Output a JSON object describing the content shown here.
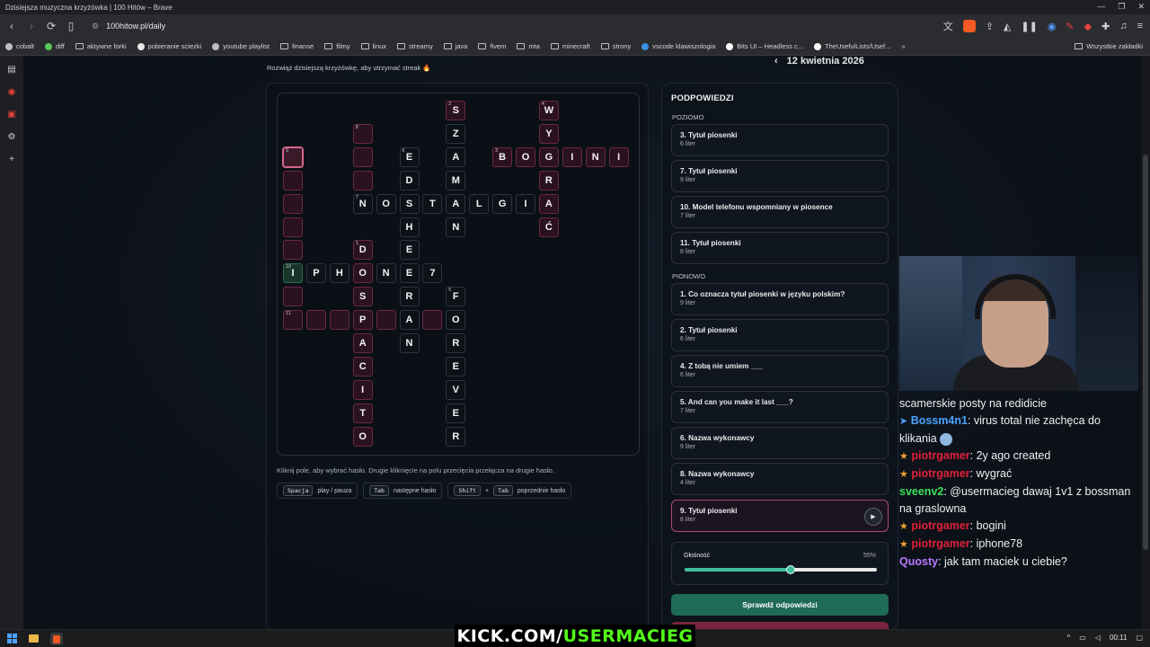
{
  "window": {
    "title": "Dzisiejsza muzyczna krzyżówka | 100 Hitów – Brave"
  },
  "addressbar": {
    "url": "100hitow.pl/daily"
  },
  "bookmarks": [
    "cobalt",
    "diff",
    "aktywne forki",
    "pobieranie sciezki",
    "youtube playlist",
    "finanse",
    "filmy",
    "linux",
    "streamy",
    "java",
    "fivem",
    "mta",
    "minecraft",
    "strony",
    "vscode klawiszologia",
    "Bits UI – Headless c...",
    "TheUsefulLists/Usef...",
    "Wszystkie zakładki"
  ],
  "page": {
    "subtitle": "Rozwiąż dzisiejszą krzyżówkę, aby utrzymać streak 🔥",
    "date": "12 kwietnia 2026",
    "hint_text": "Kliknij pole, aby wybrać hasło. Drugie kliknięcie na polu przecięcia przełącza na drugie hasło.",
    "keys": [
      {
        "keys": [
          "Spacja"
        ],
        "label": "play / pauza"
      },
      {
        "keys": [
          "Tab"
        ],
        "label": "następne hasło"
      },
      {
        "keys": [
          "Shift",
          "Tab"
        ],
        "label": "poprzednie hasło"
      }
    ]
  },
  "clues": {
    "title": "PODPOWIEDZI",
    "across_label": "POZIOMO",
    "down_label": "PIONOWO",
    "across": [
      {
        "title": "3. Tytuł piosenki",
        "len": "6 liter"
      },
      {
        "title": "7. Tytuł piosenki",
        "len": "9 liter"
      },
      {
        "title": "10. Model telefonu wspomniany w piosence",
        "len": "7 liter"
      },
      {
        "title": "11. Tytuł piosenki",
        "len": "8 liter"
      }
    ],
    "down": [
      {
        "title": "1. Co oznacza tytuł piosenki w języku polskim?",
        "len": "9 liter"
      },
      {
        "title": "2. Tytuł piosenki",
        "len": "6 liter"
      },
      {
        "title": "4. Z tobą nie umiem ___",
        "len": "6 liter"
      },
      {
        "title": "5. And can you make it last ___?",
        "len": "7 liter"
      },
      {
        "title": "6. Nazwa wykonawcy",
        "len": "9 liter"
      },
      {
        "title": "8. Nazwa wykonawcy",
        "len": "4 liter"
      },
      {
        "title": "9. Tytuł piosenki",
        "len": "8 liter"
      }
    ],
    "volume_label": "Głośność",
    "volume_value": "55%",
    "volume_fraction": 0.55,
    "check_button": "Sprawdź odpowiedzi"
  },
  "chat": [
    {
      "user": "",
      "text": "scamerskie posty na redidicie",
      "color": ""
    },
    {
      "user": "Bossm4n1",
      "text": ": virus total nie zachęca do klikania",
      "color": "blue",
      "badge": "pin"
    },
    {
      "user": "piotrgamer",
      "text": ": 2y ago created",
      "color": "red",
      "badge": "star"
    },
    {
      "user": "piotrgamer",
      "text": ": wygrać",
      "color": "red",
      "badge": "star"
    },
    {
      "user": "sveenv2",
      "text": ": @usermacieg dawaj 1v1 z bossman na graslowna",
      "color": "green",
      "badge": ""
    },
    {
      "user": "piotrgamer",
      "text": ": bogini",
      "color": "red",
      "badge": "star"
    },
    {
      "user": "piotrgamer",
      "text": ": iphone78",
      "color": "red",
      "badge": "star"
    },
    {
      "user": "Quosty",
      "text": ": jak tam maciek u ciebie?",
      "color": "purple",
      "badge": ""
    }
  ],
  "overlay": {
    "kick_prefix": "KICK.COM/",
    "kick_name": "USERMACIEG"
  },
  "taskbar": {
    "time": "00:11"
  },
  "grid": {
    "cells": [
      {
        "c": 7,
        "r": 0,
        "l": "S",
        "n": "2",
        "t": "pink"
      },
      {
        "c": 11,
        "r": 0,
        "l": "W",
        "n": "4",
        "t": "pink"
      },
      {
        "c": 3,
        "r": 1,
        "l": "",
        "n": "8",
        "t": "pink"
      },
      {
        "c": 7,
        "r": 1,
        "l": "Z",
        "n": "",
        "t": ""
      },
      {
        "c": 11,
        "r": 1,
        "l": "Y",
        "n": "",
        "t": "pink"
      },
      {
        "c": 0,
        "r": 2,
        "l": "",
        "n": "9",
        "t": "sel"
      },
      {
        "c": 3,
        "r": 2,
        "l": "",
        "n": "",
        "t": "pink"
      },
      {
        "c": 5,
        "r": 2,
        "l": "E",
        "n": "6",
        "t": ""
      },
      {
        "c": 7,
        "r": 2,
        "l": "A",
        "n": "",
        "t": ""
      },
      {
        "c": 9,
        "r": 2,
        "l": "B",
        "n": "3",
        "t": "pink"
      },
      {
        "c": 10,
        "r": 2,
        "l": "O",
        "n": "",
        "t": "pink"
      },
      {
        "c": 11,
        "r": 2,
        "l": "G",
        "n": "",
        "t": "pink"
      },
      {
        "c": 12,
        "r": 2,
        "l": "I",
        "n": "",
        "t": "pink"
      },
      {
        "c": 13,
        "r": 2,
        "l": "N",
        "n": "",
        "t": "pink"
      },
      {
        "c": 14,
        "r": 2,
        "l": "I",
        "n": "",
        "t": "pink"
      },
      {
        "c": 0,
        "r": 3,
        "l": "",
        "n": "",
        "t": "pink"
      },
      {
        "c": 3,
        "r": 3,
        "l": "",
        "n": "",
        "t": "pink"
      },
      {
        "c": 5,
        "r": 3,
        "l": "D",
        "n": "",
        "t": ""
      },
      {
        "c": 7,
        "r": 3,
        "l": "M",
        "n": "",
        "t": ""
      },
      {
        "c": 11,
        "r": 3,
        "l": "R",
        "n": "",
        "t": "pink"
      },
      {
        "c": 0,
        "r": 4,
        "l": "",
        "n": "",
        "t": "pink"
      },
      {
        "c": 3,
        "r": 4,
        "l": "N",
        "n": "7",
        "t": ""
      },
      {
        "c": 4,
        "r": 4,
        "l": "O",
        "n": "",
        "t": ""
      },
      {
        "c": 5,
        "r": 4,
        "l": "S",
        "n": "",
        "t": ""
      },
      {
        "c": 6,
        "r": 4,
        "l": "T",
        "n": "",
        "t": ""
      },
      {
        "c": 7,
        "r": 4,
        "l": "A",
        "n": "",
        "t": ""
      },
      {
        "c": 8,
        "r": 4,
        "l": "L",
        "n": "",
        "t": ""
      },
      {
        "c": 9,
        "r": 4,
        "l": "G",
        "n": "",
        "t": ""
      },
      {
        "c": 10,
        "r": 4,
        "l": "I",
        "n": "",
        "t": ""
      },
      {
        "c": 11,
        "r": 4,
        "l": "A",
        "n": "",
        "t": "pink"
      },
      {
        "c": 0,
        "r": 5,
        "l": "",
        "n": "",
        "t": "pink"
      },
      {
        "c": 5,
        "r": 5,
        "l": "H",
        "n": "",
        "t": ""
      },
      {
        "c": 7,
        "r": 5,
        "l": "N",
        "n": "",
        "t": ""
      },
      {
        "c": 11,
        "r": 5,
        "l": "Ć",
        "n": "",
        "t": "pink"
      },
      {
        "c": 0,
        "r": 6,
        "l": "",
        "n": "",
        "t": "pink"
      },
      {
        "c": 3,
        "r": 6,
        "l": "D",
        "n": "1",
        "t": "pink"
      },
      {
        "c": 5,
        "r": 6,
        "l": "E",
        "n": "",
        "t": ""
      },
      {
        "c": 0,
        "r": 7,
        "l": "I",
        "n": "10",
        "t": "green"
      },
      {
        "c": 1,
        "r": 7,
        "l": "P",
        "n": "",
        "t": ""
      },
      {
        "c": 2,
        "r": 7,
        "l": "H",
        "n": "",
        "t": ""
      },
      {
        "c": 3,
        "r": 7,
        "l": "O",
        "n": "",
        "t": "pink"
      },
      {
        "c": 4,
        "r": 7,
        "l": "N",
        "n": "",
        "t": ""
      },
      {
        "c": 5,
        "r": 7,
        "l": "E",
        "n": "",
        "t": ""
      },
      {
        "c": 6,
        "r": 7,
        "l": "7",
        "n": "",
        "t": ""
      },
      {
        "c": 0,
        "r": 8,
        "l": "",
        "n": "",
        "t": "pink"
      },
      {
        "c": 3,
        "r": 8,
        "l": "S",
        "n": "",
        "t": "pink"
      },
      {
        "c": 5,
        "r": 8,
        "l": "R",
        "n": "",
        "t": ""
      },
      {
        "c": 7,
        "r": 8,
        "l": "F",
        "n": "5",
        "t": ""
      },
      {
        "c": 0,
        "r": 9,
        "l": "",
        "n": "11",
        "t": "pink"
      },
      {
        "c": 1,
        "r": 9,
        "l": "",
        "n": "",
        "t": "pink"
      },
      {
        "c": 2,
        "r": 9,
        "l": "",
        "n": "",
        "t": "pink"
      },
      {
        "c": 3,
        "r": 9,
        "l": "P",
        "n": "",
        "t": "pink"
      },
      {
        "c": 4,
        "r": 9,
        "l": "",
        "n": "",
        "t": "pink"
      },
      {
        "c": 5,
        "r": 9,
        "l": "A",
        "n": "",
        "t": ""
      },
      {
        "c": 6,
        "r": 9,
        "l": "",
        "n": "",
        "t": "pink"
      },
      {
        "c": 7,
        "r": 9,
        "l": "O",
        "n": "",
        "t": ""
      },
      {
        "c": 3,
        "r": 10,
        "l": "A",
        "n": "",
        "t": "pink"
      },
      {
        "c": 5,
        "r": 10,
        "l": "N",
        "n": "",
        "t": ""
      },
      {
        "c": 7,
        "r": 10,
        "l": "R",
        "n": "",
        "t": ""
      },
      {
        "c": 3,
        "r": 11,
        "l": "C",
        "n": "",
        "t": "pink"
      },
      {
        "c": 7,
        "r": 11,
        "l": "E",
        "n": "",
        "t": ""
      },
      {
        "c": 3,
        "r": 12,
        "l": "I",
        "n": "",
        "t": "pink"
      },
      {
        "c": 7,
        "r": 12,
        "l": "V",
        "n": "",
        "t": ""
      },
      {
        "c": 3,
        "r": 13,
        "l": "T",
        "n": "",
        "t": "pink"
      },
      {
        "c": 7,
        "r": 13,
        "l": "E",
        "n": "",
        "t": ""
      },
      {
        "c": 3,
        "r": 14,
        "l": "O",
        "n": "",
        "t": "pink"
      },
      {
        "c": 7,
        "r": 14,
        "l": "R",
        "n": "",
        "t": ""
      }
    ]
  }
}
